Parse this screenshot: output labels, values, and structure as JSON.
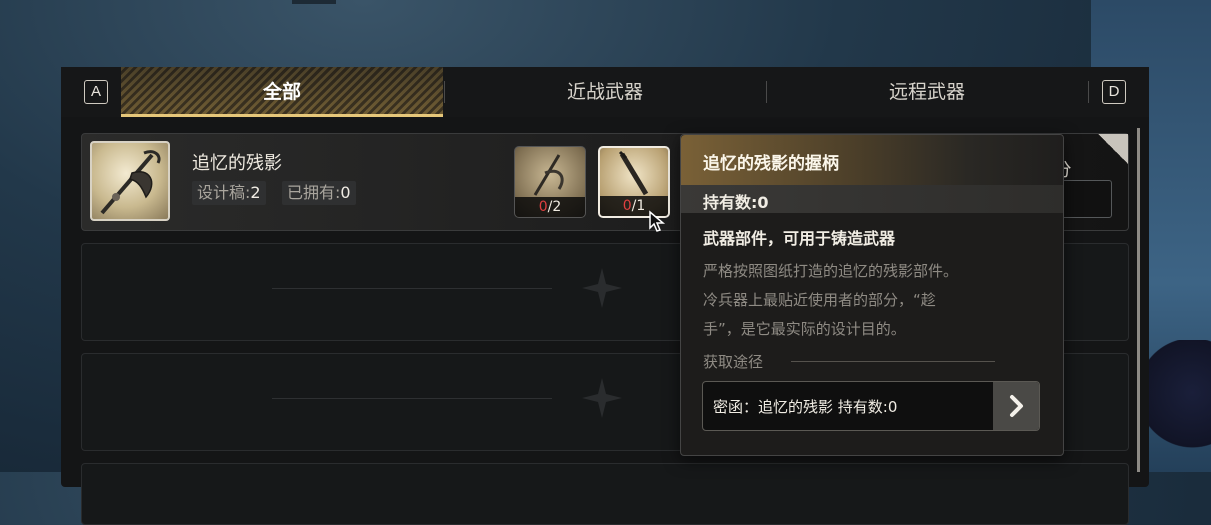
{
  "tabs": {
    "key_left": "A",
    "key_right": "D",
    "all": "全部",
    "melee": "近战武器",
    "ranged": "远程武器"
  },
  "item": {
    "name": "追忆的残影",
    "design_label": "设计稿:",
    "design_count": "2",
    "owned_label": "已拥有:",
    "owned_count": "0",
    "parts": [
      {
        "have": "0",
        "need": "/2"
      },
      {
        "have": "0",
        "need": "/1"
      }
    ],
    "right_fragment": "0分"
  },
  "tooltip": {
    "title": "追忆的残影的握柄",
    "hold": "持有数:0",
    "type": "武器部件，可用于铸造武器",
    "desc_lines": [
      "严格按照图纸打造的追忆的残影部件。",
      "冷兵器上最贴近使用者的部分，“趁",
      "手”，是它最实际的设计目的。"
    ],
    "source_label": "获取途径",
    "source_text": "密函：追忆的残影 持有数:0"
  },
  "colors": {
    "accent_gold": "#e6c77a",
    "count_red": "#e04040",
    "panel_bg": "#141516"
  }
}
